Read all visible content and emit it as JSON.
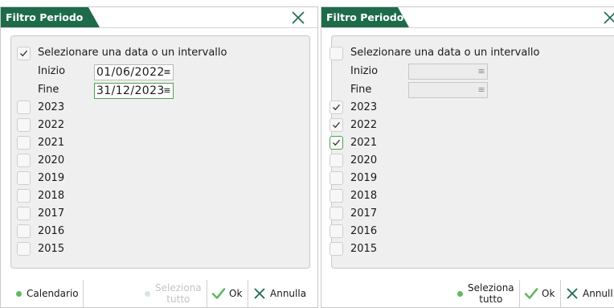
{
  "colors": {
    "accent": "#1e6b4b",
    "check_green": "#49a44d",
    "dot_green": "#62b865"
  },
  "left_dialog": {
    "title": "Filtro Periodo",
    "close_icon": "close-x-icon",
    "range_label": "Selezionare una data o un intervallo",
    "range_checked": true,
    "inizio_label": "Inizio",
    "inizio_value": "01/06/2022",
    "fine_label": "Fine",
    "fine_value": "31/12/2023",
    "dropdown_glyph": "≡",
    "years": [
      {
        "label": "2023",
        "checked": false
      },
      {
        "label": "2022",
        "checked": false
      },
      {
        "label": "2021",
        "checked": false
      },
      {
        "label": "2020",
        "checked": false
      },
      {
        "label": "2019",
        "checked": false
      },
      {
        "label": "2018",
        "checked": false
      },
      {
        "label": "2017",
        "checked": false
      },
      {
        "label": "2016",
        "checked": false
      },
      {
        "label": "2015",
        "checked": false
      }
    ],
    "buttons": {
      "calendario": "Calendario",
      "seleziona_1": "Seleziona",
      "seleziona_2": "tutto",
      "ok": "Ok",
      "annulla": "Annulla"
    }
  },
  "right_dialog": {
    "title": "Filtro Periodo",
    "close_icon": "close-x-icon",
    "range_label": "Selezionare una data o un intervallo",
    "range_checked": false,
    "inizio_label": "Inizio",
    "inizio_value": "",
    "fine_label": "Fine",
    "fine_value": "",
    "dropdown_glyph": "≡",
    "years": [
      {
        "label": "2023",
        "checked": true
      },
      {
        "label": "2022",
        "checked": true
      },
      {
        "label": "2021",
        "checked": true
      },
      {
        "label": "2020",
        "checked": false
      },
      {
        "label": "2019",
        "checked": false
      },
      {
        "label": "2018",
        "checked": false
      },
      {
        "label": "2017",
        "checked": false
      },
      {
        "label": "2016",
        "checked": false
      },
      {
        "label": "2015",
        "checked": false
      }
    ],
    "buttons": {
      "seleziona_1": "Seleziona",
      "seleziona_2": "tutto",
      "ok": "Ok",
      "annulla": "Annull"
    }
  }
}
